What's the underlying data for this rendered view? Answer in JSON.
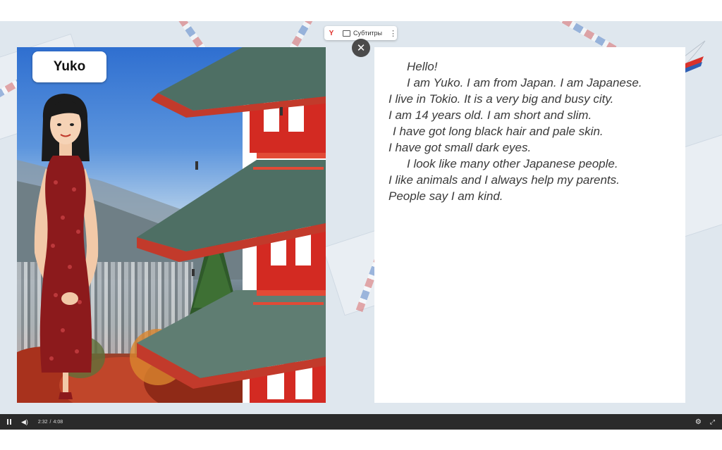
{
  "character_name": "Yuko",
  "subtitles_label": "Субтитры",
  "close_glyph": "✕",
  "story_lines": [
    "Hello!",
    "I am Yuko. I am from Japan. I am Japanese.",
    "I live in Tokio. It is a very big and busy city.",
    "I am 14 years old. I am short and slim.",
    "I have got long black hair and pale skin.",
    "I have got small dark eyes.",
    "I look like many other Japanese people.",
    "I like animals and I always help my parents.",
    "People say I am kind."
  ],
  "player": {
    "current_time": "2:32",
    "separator": "/",
    "duration": "4:08",
    "progress": 0.61
  },
  "icons": {
    "browser": "yandex-logo-icon",
    "subtitles": "subtitles-icon",
    "more": "more-vertical-icon",
    "play_pause": "pause-icon",
    "volume": "volume-icon",
    "settings": "gear-icon",
    "fullscreen": "fullscreen-icon"
  },
  "colors": {
    "accent_red": "#e0312b",
    "dress_red": "#8c1a1c",
    "player_bar": "#2a2a2a"
  }
}
